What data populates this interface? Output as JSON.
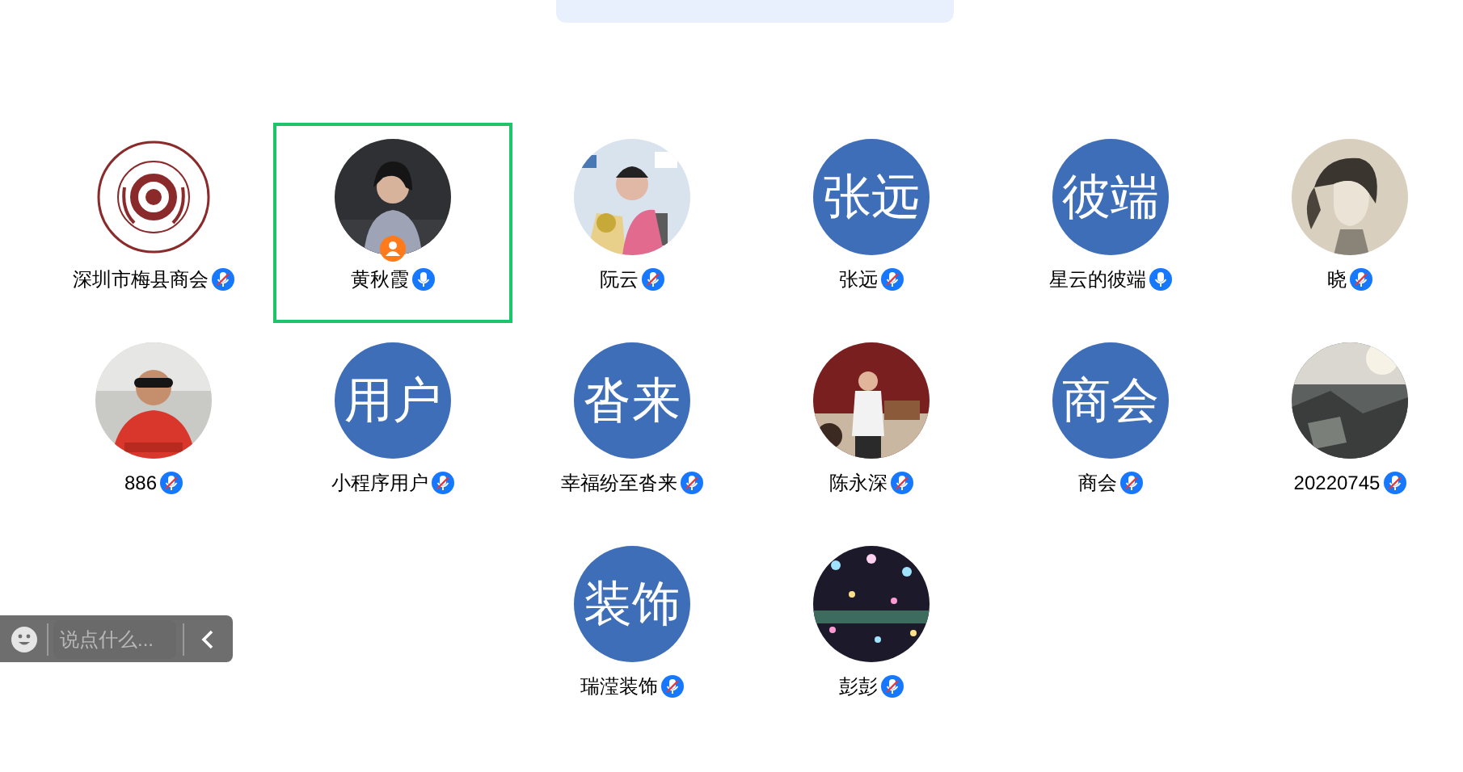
{
  "participant_rows": [
    [
      {
        "name": "深圳市梅县商会",
        "avatar": {
          "kind": "logo"
        },
        "mic_muted": true,
        "host": false,
        "selected": false
      },
      {
        "name": "黄秋霞",
        "mic_muted": false,
        "host": true,
        "selected": true
      },
      {
        "name": "阮云",
        "mic_muted": true,
        "host": false,
        "selected": false
      },
      {
        "name": "张远",
        "avatar": {
          "kind": "initials",
          "text": "张远"
        },
        "mic_muted": true,
        "host": false,
        "selected": false
      },
      {
        "name": "星云的彼端",
        "avatar": {
          "kind": "initials",
          "text": "彼端"
        },
        "mic_muted": false,
        "host": false,
        "selected": false
      },
      {
        "name": "晓",
        "mic_muted": true,
        "host": false,
        "selected": false
      }
    ],
    [
      {
        "name": "886",
        "mic_muted": true,
        "host": false,
        "selected": false
      },
      {
        "name": "小程序用户",
        "avatar": {
          "kind": "initials",
          "text": "用户"
        },
        "mic_muted": true,
        "host": false,
        "selected": false
      },
      {
        "name": "幸福纷至沓来",
        "avatar": {
          "kind": "initials",
          "text": "沓来"
        },
        "mic_muted": true,
        "host": false,
        "selected": false
      },
      {
        "name": "陈永深",
        "mic_muted": true,
        "host": false,
        "selected": false
      },
      {
        "name": "商会",
        "avatar": {
          "kind": "initials",
          "text": "商会"
        },
        "mic_muted": true,
        "host": false,
        "selected": false
      },
      {
        "name": "20220745",
        "mic_muted": true,
        "host": false,
        "selected": false
      }
    ],
    [
      {
        "name": "瑞滢装饰",
        "avatar": {
          "kind": "initials",
          "text": "装饰"
        },
        "mic_muted": true,
        "host": false,
        "selected": false
      },
      {
        "name": "彭彭",
        "mic_muted": true,
        "host": false,
        "selected": false
      }
    ]
  ],
  "chat_bar": {
    "placeholder": "说点什么..."
  }
}
